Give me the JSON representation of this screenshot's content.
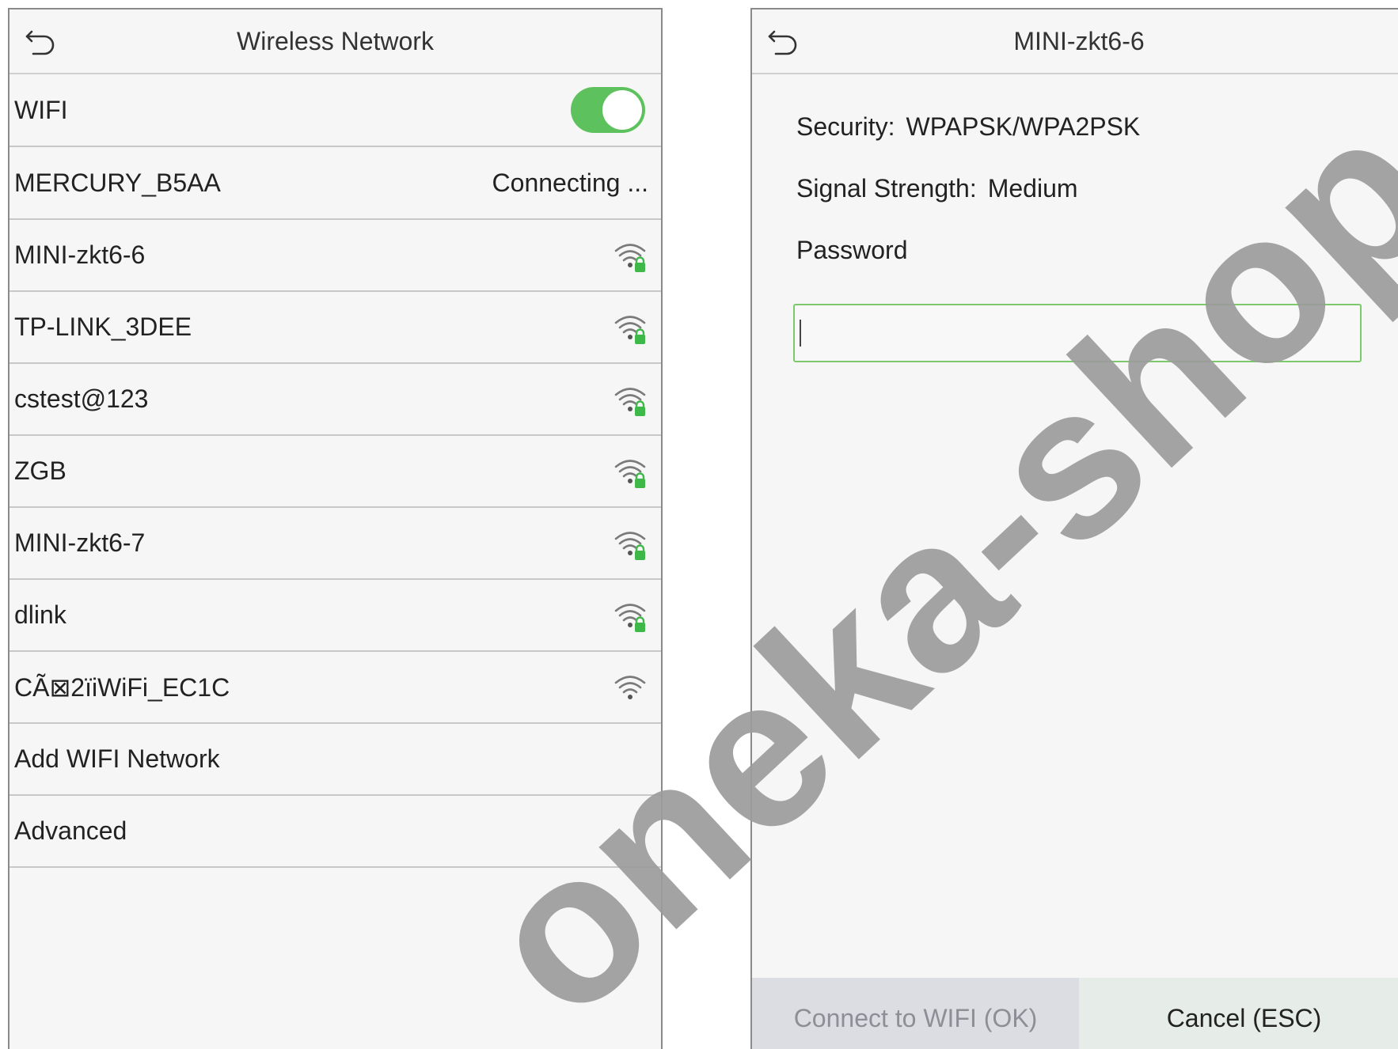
{
  "left": {
    "title": "Wireless Network",
    "wifi_label": "WIFI",
    "wifi_enabled": true,
    "connecting": {
      "name": "MERCURY_B5AA",
      "status": "Connecting ..."
    },
    "networks": [
      {
        "name": "MINI-zkt6-6",
        "icon": "wifi-locked-icon"
      },
      {
        "name": "TP-LINK_3DEE",
        "icon": "wifi-locked-icon"
      },
      {
        "name": "cstest@123",
        "icon": "wifi-locked-icon"
      },
      {
        "name": "ZGB",
        "icon": "wifi-locked-icon"
      },
      {
        "name": "MINI-zkt6-7",
        "icon": "wifi-locked-icon"
      },
      {
        "name": "dlink",
        "icon": "wifi-locked-icon"
      },
      {
        "name": " CÃ⊠2ïiWiFi_EC1C",
        "icon": "wifi-icon"
      }
    ],
    "add_network": "Add WIFI Network",
    "advanced": "Advanced"
  },
  "right": {
    "title": "MINI-zkt6-6",
    "security_label": "Security:",
    "security_value": "WPAPSK/WPA2PSK",
    "signal_label": "Signal Strength:",
    "signal_value": "Medium",
    "password_label": "Password",
    "password_value": "",
    "connect_button": "Connect to WIFI (OK)",
    "cancel_button": "Cancel (ESC)"
  },
  "watermark": "oneka-shop.com",
  "colors": {
    "toggle_on": "#5dc25d",
    "input_border": "#7cc96b",
    "lock": "#3fb84a"
  }
}
